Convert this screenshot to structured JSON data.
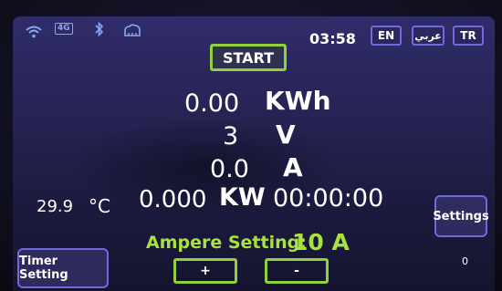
{
  "status_bar": {
    "wifi_icon": "wifi-icon",
    "network_label": "4G",
    "bluetooth_icon": "bluetooth-icon",
    "cloud_icon": "cloud-icon",
    "clock": "03:58"
  },
  "languages": [
    {
      "label": "EN"
    },
    {
      "label": "عربي"
    },
    {
      "label": "TR"
    }
  ],
  "start_label": "START",
  "readings": {
    "energy": {
      "value": "0.00",
      "unit": "KWh"
    },
    "voltage": {
      "value": "3",
      "unit": "V"
    },
    "current": {
      "value": "0.0",
      "unit": "A"
    },
    "temperature": {
      "value": "29.9",
      "unit": "°C"
    },
    "power": {
      "value": "0.000",
      "unit": "KW"
    },
    "elapsed": "00:00:00"
  },
  "settings_label": "Settings",
  "ampere": {
    "label": "Ampere Setting:",
    "value": "10 A"
  },
  "timer_setting_label": "Timer Setting",
  "stepper": {
    "plus": "+",
    "minus": "-"
  },
  "counter": "0",
  "colors": {
    "accent_green": "#8fd13a",
    "button_border": "#6f6ae0",
    "screen_bg": "#2a2760"
  }
}
